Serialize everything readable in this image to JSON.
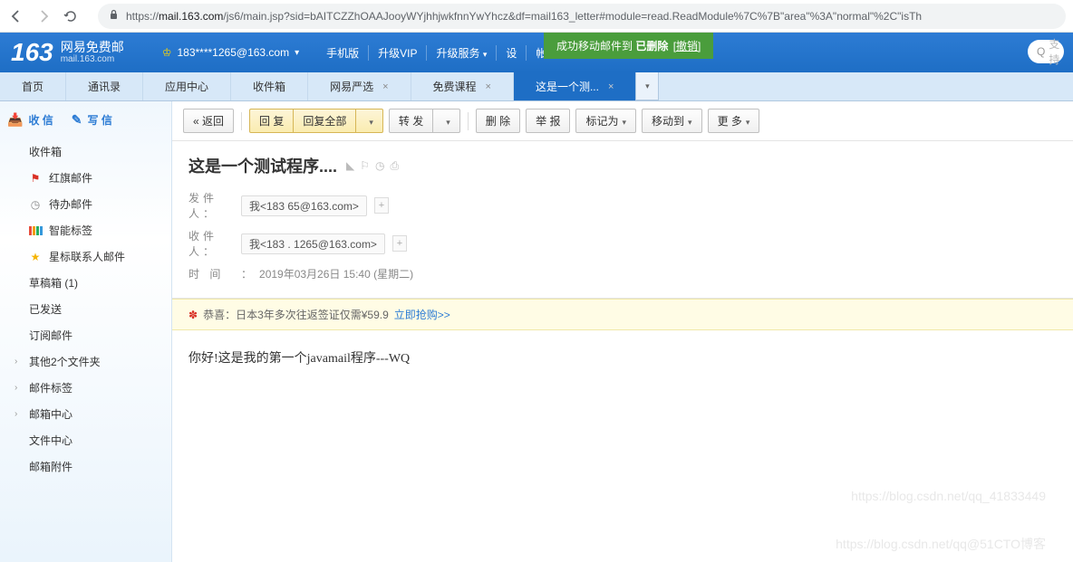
{
  "browser": {
    "url_proto": "https://",
    "url_host": "mail.163.com",
    "url_path": "/js6/main.jsp?sid=bAITCZZhOAAJooyWYjhhjwkfnnYwYhcz&df=mail163_letter#module=read.ReadModule%7C%7B\"area\"%3A\"normal\"%2C\"isTh"
  },
  "header": {
    "logo_num": "163",
    "logo_cn": "网易免费邮",
    "logo_en": "mail.163.com",
    "user_email": "183****1265@163.com",
    "links": [
      "手机版",
      "升级VIP",
      "升级服务",
      "设",
      "帐"
    ],
    "toast_pre": "成功移动邮件到 ",
    "toast_bold": "已删除",
    "toast_undo": "[撤销]",
    "search_placeholder": "支持"
  },
  "tabs": [
    {
      "label": "首页",
      "closable": false
    },
    {
      "label": "通讯录",
      "closable": false
    },
    {
      "label": "应用中心",
      "closable": false
    },
    {
      "label": "收件箱",
      "closable": false
    },
    {
      "label": "网易严选",
      "closable": true
    },
    {
      "label": "免费课程",
      "closable": true
    },
    {
      "label": "这是一个测...",
      "closable": true,
      "active": true
    }
  ],
  "sidebar": {
    "receive": "收 信",
    "compose": "写 信",
    "items": [
      {
        "label": "收件箱"
      },
      {
        "label": "红旗邮件",
        "icon": "flag-red"
      },
      {
        "label": "待办邮件",
        "icon": "clock-gray"
      },
      {
        "label": "智能标签",
        "icon": "tag-multi"
      },
      {
        "label": "星标联系人邮件",
        "icon": "star-yellow"
      },
      {
        "label": "草稿箱 (1)"
      },
      {
        "label": "已发送"
      },
      {
        "label": "订阅邮件"
      },
      {
        "label": "其他2个文件夹",
        "expandable": true
      },
      {
        "label": "邮件标签",
        "expandable": true
      },
      {
        "label": "邮箱中心",
        "expandable": true
      },
      {
        "label": "文件中心"
      },
      {
        "label": "邮箱附件"
      }
    ]
  },
  "toolbar": {
    "back": "返回",
    "reply": "回 复",
    "reply_all": "回复全部",
    "forward": "转 发",
    "delete": "删 除",
    "report": "举 报",
    "mark": "标记为",
    "move": "移动到",
    "more": "更 多"
  },
  "mail": {
    "subject": "这是一个测试程序....",
    "from_label": "发件人",
    "from_value": "我<183        65@163.com>",
    "to_label": "收件人",
    "to_value": "我<183 .   1265@163.com>",
    "date_label": "时   间",
    "date_value": "2019年03月26日 15:40 (星期二)",
    "promo_text": "恭喜：日本3年多次往返签证仅需¥59.9 ",
    "promo_link": "立即抢购>>",
    "body": "你好!这是我的第一个javamail程序---WQ"
  },
  "watermarks": {
    "w1": "https://blog.csdn.net/qq_41833449",
    "w2": "https://blog.csdn.net/qq@51CTO博客"
  }
}
